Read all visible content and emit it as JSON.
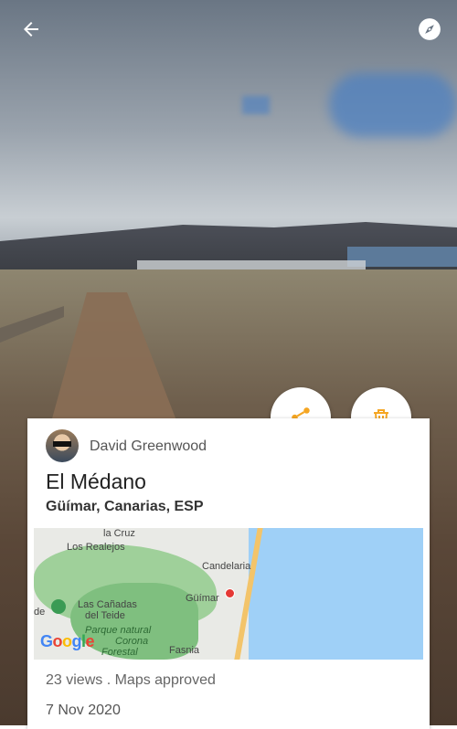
{
  "header": {
    "back_icon": "arrow-left-icon",
    "compass_icon": "compass-icon"
  },
  "actions": {
    "share_icon": "share-icon",
    "delete_icon": "trash-icon",
    "accent_color": "#f5a623"
  },
  "card": {
    "author": "David Greenwood",
    "title": "El Médano",
    "location": "Güímar, Canarias, ESP",
    "stats": "23 views . Maps approved",
    "date": "7 Nov 2020"
  },
  "map": {
    "labels": {
      "la_cruz": "la Cruz",
      "los_realejos": "Los Realejos",
      "candelaria": "Candelaria",
      "guimar": "Güímar",
      "de": "de",
      "las_canadas": "Las Cañadas",
      "del_teide": "del Teide",
      "parque1": "Parque natural",
      "parque2": "Corona",
      "parque3": "Forestal",
      "fasnia": "Fasnia",
      "google": "Google"
    }
  }
}
